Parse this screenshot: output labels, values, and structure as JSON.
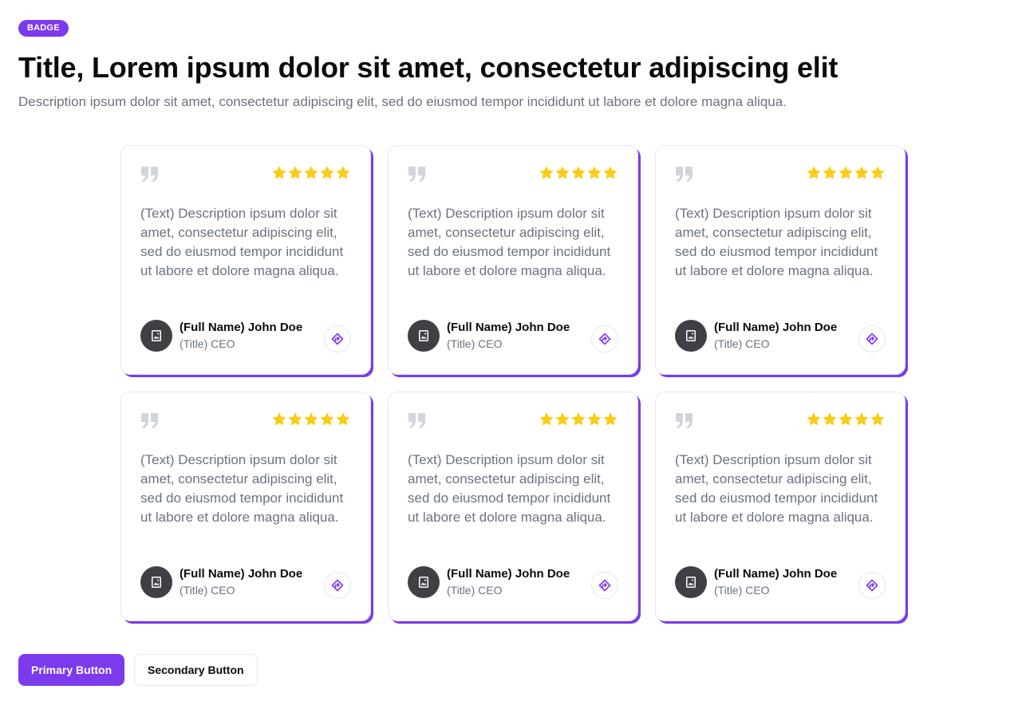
{
  "header": {
    "badge": "BADGE",
    "title": "Title, Lorem ipsum dolor sit amet, consectetur adipiscing elit",
    "description": "Description ipsum dolor sit amet, consectetur adipiscing elit, sed do eiusmod tempor incididunt ut labore et dolore magna aliqua."
  },
  "colors": {
    "accent": "#7c3aed",
    "star": "#facc15",
    "quote": "#d1d5db",
    "avatar": "#3f3f46"
  },
  "icons": {
    "quote": "quote-icon",
    "star": "star-icon",
    "avatar": "image-placeholder-icon",
    "share": "share-icon"
  },
  "testimonials": [
    {
      "rating": 5,
      "text": "(Text) Description ipsum dolor sit amet, consectetur adipiscing elit, sed do eiusmod tempor incididunt ut labore et dolore magna aliqua.",
      "name": "(Full Name) John Doe",
      "title_prefix": "(Title)",
      "title": "CEO"
    },
    {
      "rating": 5,
      "text": "(Text) Description ipsum dolor sit amet, consectetur adipiscing elit, sed do eiusmod tempor incididunt ut labore et dolore magna aliqua.",
      "name": "(Full Name) John Doe",
      "title_prefix": "(Title)",
      "title": "CEO"
    },
    {
      "rating": 5,
      "text": "(Text) Description ipsum dolor sit amet, consectetur adipiscing elit, sed do eiusmod tempor incididunt ut labore et dolore magna aliqua.",
      "name": "(Full Name) John Doe",
      "title_prefix": "(Title)",
      "title": "CEO"
    },
    {
      "rating": 5,
      "text": "(Text) Description ipsum dolor sit amet, consectetur adipiscing elit, sed do eiusmod tempor incididunt ut labore et dolore magna aliqua.",
      "name": "(Full Name) John Doe",
      "title_prefix": "(Title)",
      "title": "CEO"
    },
    {
      "rating": 5,
      "text": "(Text) Description ipsum dolor sit amet, consectetur adipiscing elit, sed do eiusmod tempor incididunt ut labore et dolore magna aliqua.",
      "name": "(Full Name) John Doe",
      "title_prefix": "(Title)",
      "title": "CEO"
    },
    {
      "rating": 5,
      "text": "(Text) Description ipsum dolor sit amet, consectetur adipiscing elit, sed do eiusmod tempor incididunt ut labore et dolore magna aliqua.",
      "name": "(Full Name) John Doe",
      "title_prefix": "(Title)",
      "title": "CEO"
    }
  ],
  "actions": {
    "primary_label": "Primary Button",
    "secondary_label": "Secondary Button"
  }
}
